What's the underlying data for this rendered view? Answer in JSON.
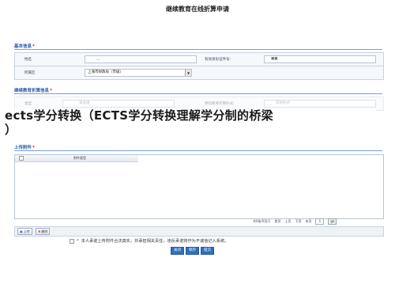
{
  "page_title": "继续教育在线折算申请",
  "basic_info": {
    "title": "基本信息",
    "required_mark": "*",
    "name_label": "姓名",
    "name_value": "__",
    "id_label": "有效身份证件号:",
    "id_value": "■■",
    "region_label": "所属区",
    "region_value": "上海市财政局（市级）"
  },
  "conversion_info": {
    "title": "继续教育折算信息",
    "required_mark": "*",
    "type_label": "类型:",
    "type_placeholder": "请选择",
    "method_label": "继续教育折算形式:",
    "method_value": "其他形式"
  },
  "overlay": {
    "line1": "ects学分转换（ECTS学分转换理解学分制的桥梁",
    "line2": "）"
  },
  "attachments": {
    "title": "上传附件",
    "required_mark": "*",
    "column_header": "附件类型",
    "pager": {
      "summary": "共0条/0页/1",
      "first": "首页",
      "prev": "上页",
      "next": "下页",
      "last": "末页",
      "page_value": "1",
      "go": "go"
    },
    "upload_label": "上传",
    "delete_label": "删除"
  },
  "pledge": {
    "mark": "*",
    "text": "本人承诺上传附件合法真实，并承担相关责任，违反承诺将作为不诚信记入系统。"
  },
  "actions": {
    "close": "关闭",
    "save": "保存",
    "submit": "提交"
  }
}
